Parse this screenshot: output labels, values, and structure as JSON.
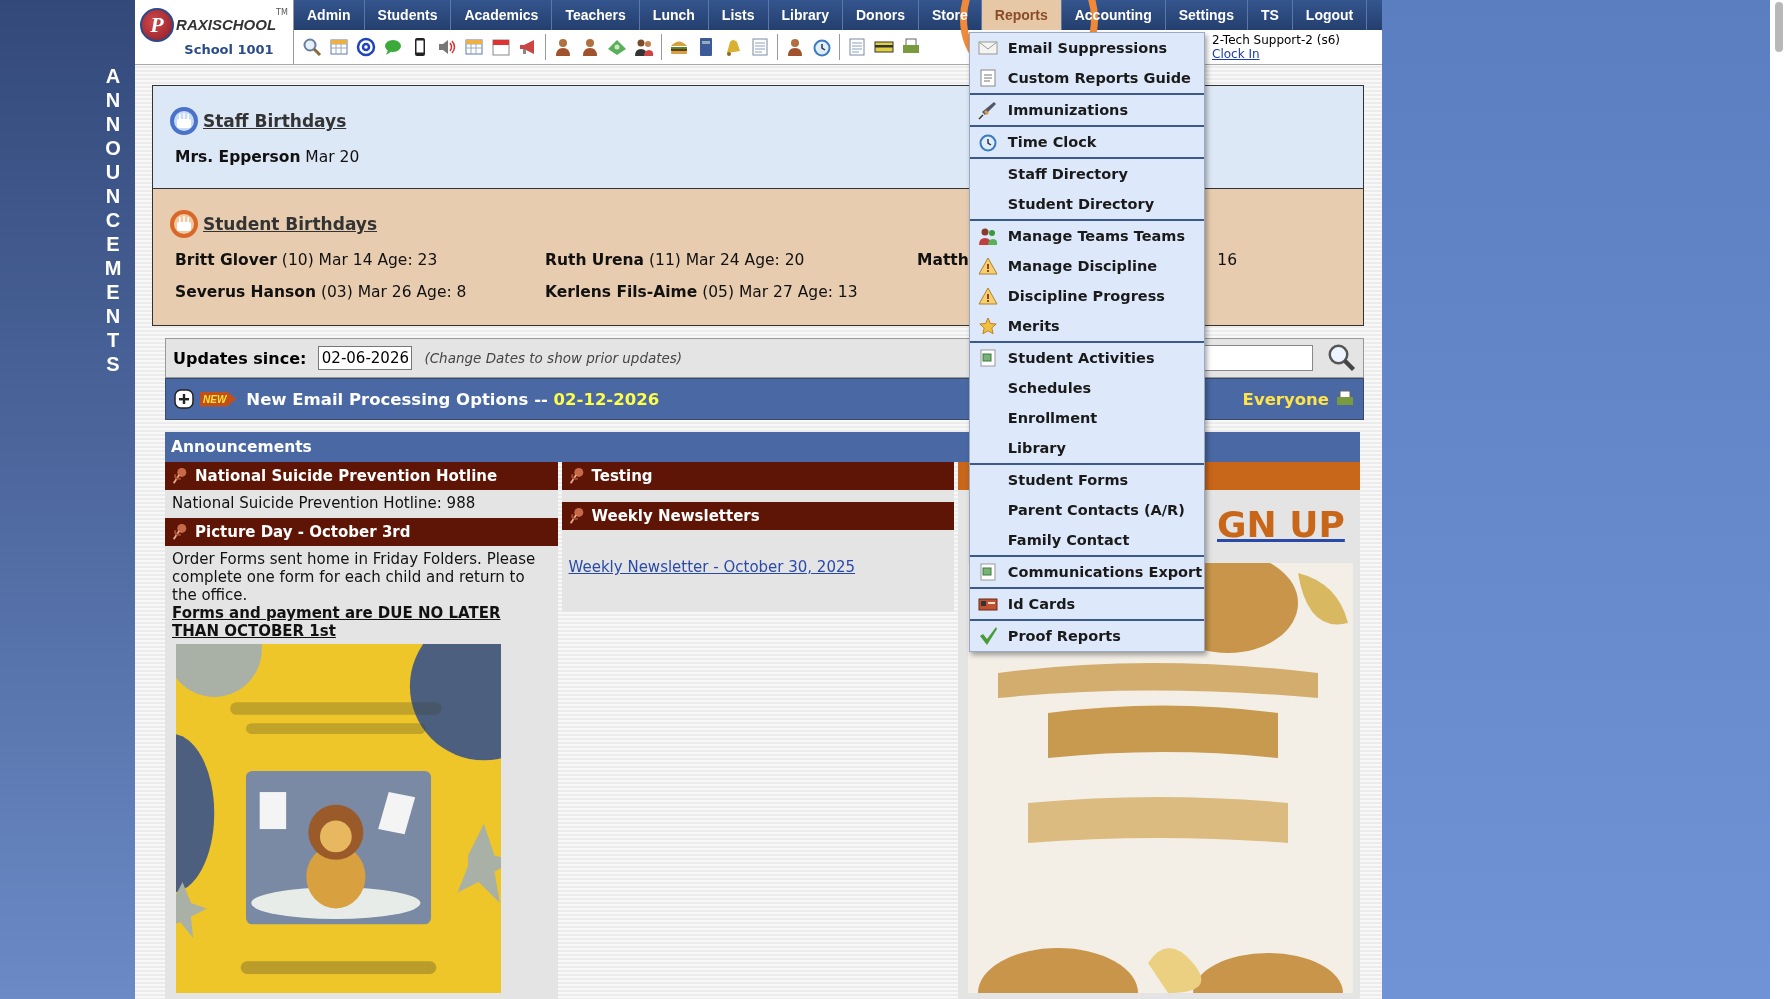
{
  "logo": {
    "mark": "P",
    "wordmark": "RAXISCHOOL",
    "tm": "TM",
    "school": "School 1001"
  },
  "nav": [
    {
      "label": "Admin",
      "selected": false
    },
    {
      "label": "Students",
      "selected": false
    },
    {
      "label": "Academics",
      "selected": false
    },
    {
      "label": "Teachers",
      "selected": false
    },
    {
      "label": "Lunch",
      "selected": false
    },
    {
      "label": "Lists",
      "selected": false
    },
    {
      "label": "Library",
      "selected": false
    },
    {
      "label": "Donors",
      "selected": false
    },
    {
      "label": "Store",
      "selected": false
    },
    {
      "label": "Reports",
      "selected": true
    },
    {
      "label": "Accounting",
      "selected": false
    },
    {
      "label": "Settings",
      "selected": false
    },
    {
      "label": "TS",
      "selected": false
    },
    {
      "label": "Logout",
      "selected": false
    }
  ],
  "user": {
    "name": "2-Tech Support-2 (s6)",
    "link": "Clock In"
  },
  "reports_menu": {
    "groups": [
      [
        {
          "label": "Email Suppressions"
        },
        {
          "label": "Custom Reports Guide"
        }
      ],
      [
        {
          "label": "Immunizations"
        }
      ],
      [
        {
          "label": "Time Clock"
        }
      ],
      [
        {
          "label": "Staff Directory"
        },
        {
          "label": "Student Directory"
        }
      ],
      [
        {
          "label": "Manage Teams Teams"
        },
        {
          "label": "Manage Discipline"
        },
        {
          "label": "Discipline Progress"
        },
        {
          "label": "Merits"
        }
      ],
      [
        {
          "label": "Student Activities"
        },
        {
          "label": "Schedules"
        },
        {
          "label": "Enrollment"
        },
        {
          "label": "Library"
        }
      ],
      [
        {
          "label": "Student Forms"
        },
        {
          "label": "Parent Contacts (A/R)"
        },
        {
          "label": "Family Contact"
        }
      ],
      [
        {
          "label": "Communications Export"
        }
      ],
      [
        {
          "label": "Id Cards"
        }
      ],
      [
        {
          "label": "Proof Reports"
        }
      ]
    ]
  },
  "side_label": "ANNOUNCEMENTS",
  "staff_birthdays": {
    "title": "Staff Birthdays",
    "people": [
      {
        "name": "Mrs. Epperson",
        "detail": "Mar 20"
      }
    ]
  },
  "student_birthdays": {
    "title": "Student Birthdays",
    "people": [
      {
        "name": "Britt Glover",
        "detail": "(10) Mar 14 Age: 23"
      },
      {
        "name": "Ruth Urena",
        "detail": "(11) Mar 24 Age: 20"
      },
      {
        "name": "Matth",
        "detail": "16"
      },
      {
        "name": "Severus Hanson",
        "detail": "(03) Mar 26 Age: 8"
      },
      {
        "name": "Kerlens Fils-Aime",
        "detail": "(05) Mar 27 Age: 13"
      }
    ]
  },
  "updates": {
    "label": "Updates since:",
    "date": "02-06-2026",
    "hint": "(Change Dates to show prior updates)"
  },
  "update_item": {
    "badge": "NEW",
    "title": "New Email Processing Options --",
    "date": "02-12-2026",
    "audience": "Everyone",
    "expanded": false
  },
  "announcements": {
    "title": "Announcements",
    "columns": [
      [
        {
          "title": "National Suicide Prevention Hotline",
          "color": "#5e1505",
          "body": "National Suicide Prevention Hotline: 988"
        },
        {
          "title": "Picture Day - October 3rd",
          "color": "#5e1505",
          "body": "Order Forms sent home in Friday Folders. Please complete one form for each child and return to the office.",
          "note": "Forms and payment are DUE NO LATER THAN OCTOBER 1st"
        }
      ],
      [
        {
          "title": "Testing",
          "color": "#5e1505"
        },
        {
          "title": "Weekly Newsletters",
          "color": "#5e1505",
          "link": "Weekly Newsletter - October 30, 2025"
        }
      ],
      [
        {
          "color": "#c8661a",
          "big_link": "GN UP"
        }
      ]
    ]
  }
}
